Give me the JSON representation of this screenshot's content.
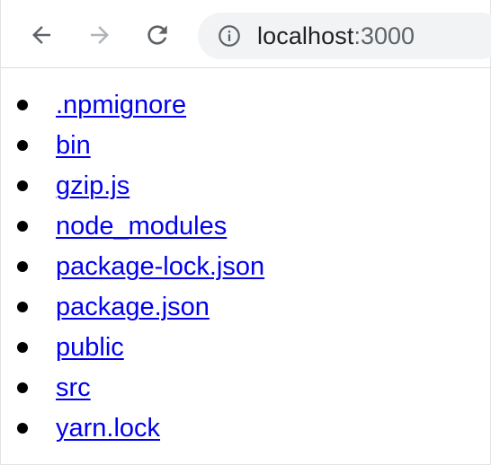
{
  "browser": {
    "address_bar": {
      "host": "localhost",
      "port": ":3000"
    },
    "nav": {
      "back_icon": "arrow-left-icon",
      "forward_icon": "arrow-right-icon",
      "reload_icon": "reload-icon",
      "site_info_icon": "info-icon"
    }
  },
  "files": [
    ".npmignore",
    "bin",
    "gzip.js",
    "node_modules",
    "package-lock.json",
    "package.json",
    "public",
    "src",
    "yarn.lock"
  ],
  "colors": {
    "link": "#0000ee",
    "omnibox_bg": "#f1f3f4",
    "icon_active": "#5f6368",
    "icon_disabled": "#b0b4b8"
  }
}
